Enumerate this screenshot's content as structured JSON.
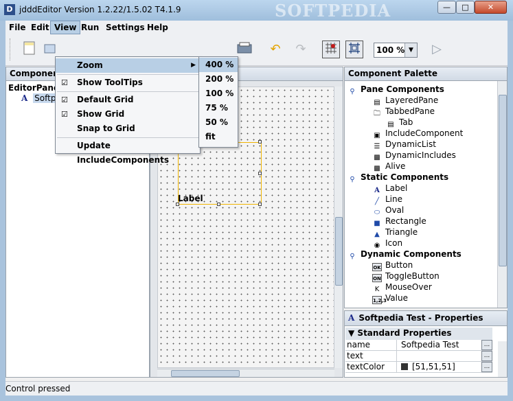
{
  "window": {
    "title": "jdddEditor Version 1.2.22/1.5.02 T4.1.9",
    "watermark": "SOFTPEDIA",
    "app_icon_letter": "D"
  },
  "menubar": {
    "items": [
      "File",
      "Edit",
      "View",
      "Run",
      "Settings",
      "Help"
    ]
  },
  "toolbar": {
    "zoom_value": "100 %"
  },
  "view_menu": {
    "items": [
      {
        "label": "Zoom",
        "checked": false,
        "submenu": true,
        "highlighted": true
      },
      {
        "label": "Show ToolTips",
        "checked": true
      },
      {
        "label": "Default Grid",
        "checked": true
      },
      {
        "label": "Show Grid",
        "checked": true
      },
      {
        "label": "Snap to Grid",
        "checked": false
      },
      {
        "label": "Update IncludeComponents",
        "checked": false
      }
    ]
  },
  "zoom_submenu": {
    "items": [
      "400 %",
      "200 %",
      "100 %",
      "75 %",
      "50 %",
      "fit"
    ]
  },
  "left_panel": {
    "title": "Componen",
    "root": "EditorPane",
    "child_icon": "A",
    "child_label": "Softp"
  },
  "canvas": {
    "label_text": "Label"
  },
  "palette": {
    "title": "Component Palette",
    "rows": [
      {
        "label": "Pane Components",
        "type": "category",
        "icon": "node-icon"
      },
      {
        "label": "LayeredPane",
        "type": "item",
        "icon": "layeredpane-icon"
      },
      {
        "label": "TabbedPane",
        "type": "item",
        "icon": "folder-icon"
      },
      {
        "label": "Tab",
        "type": "subitem",
        "icon": "tab-icon"
      },
      {
        "label": "IncludeComponent",
        "type": "item",
        "icon": "include-icon"
      },
      {
        "label": "DynamicList",
        "type": "item",
        "icon": "list-icon"
      },
      {
        "label": "DynamicIncludes",
        "type": "item",
        "icon": "includes-icon"
      },
      {
        "label": "Alive",
        "type": "item",
        "icon": "alive-icon"
      },
      {
        "label": "Static Components",
        "type": "category",
        "icon": "node-icon"
      },
      {
        "label": "Label",
        "type": "item",
        "icon": "label-icon"
      },
      {
        "label": "Line",
        "type": "item",
        "icon": "line-icon"
      },
      {
        "label": "Oval",
        "type": "item",
        "icon": "oval-icon"
      },
      {
        "label": "Rectangle",
        "type": "item",
        "icon": "rectangle-icon"
      },
      {
        "label": "Triangle",
        "type": "item",
        "icon": "triangle-icon"
      },
      {
        "label": "Icon",
        "type": "item",
        "icon": "camera-icon"
      },
      {
        "label": "Dynamic Components",
        "type": "category",
        "icon": "node-icon"
      },
      {
        "label": "Button",
        "type": "item",
        "icon": "ok-button-icon"
      },
      {
        "label": "ToggleButton",
        "type": "item",
        "icon": "on-toggle-icon"
      },
      {
        "label": "MouseOver",
        "type": "item",
        "icon": "mouseover-icon"
      },
      {
        "label": "Value",
        "type": "item",
        "icon": "value-icon"
      }
    ]
  },
  "properties": {
    "title": "Softpedia Test - Properties",
    "section": "Standard Properties",
    "rows": [
      {
        "key": "name",
        "value": "Softpedia Test"
      },
      {
        "key": "text",
        "value": ""
      },
      {
        "key": "textColor",
        "value": "[51,51,51]"
      }
    ],
    "text_color": "#333333"
  },
  "status": {
    "text": "Control pressed"
  }
}
